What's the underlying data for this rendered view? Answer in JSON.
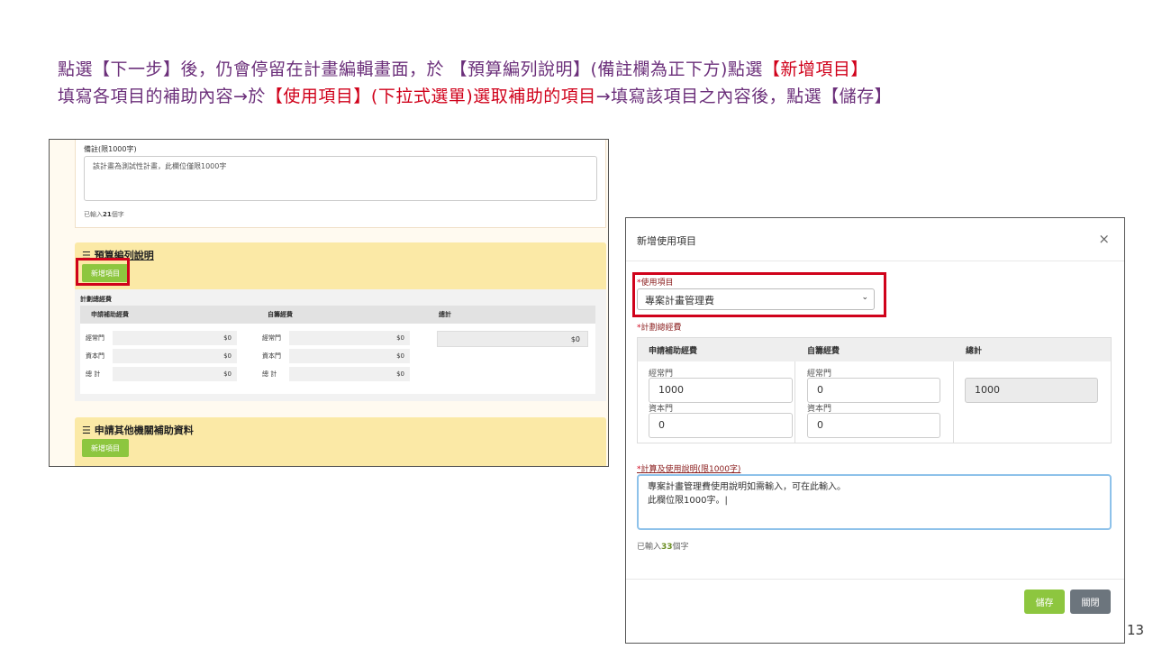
{
  "instructions": {
    "line1": [
      {
        "text": "點選【下一步】後，仍會停留在計畫編輯畫面，於 【預算編列說明】(備註欄為正下方)點選",
        "red": false
      },
      {
        "text": "【新增項目】",
        "red": true
      }
    ],
    "line2": [
      {
        "text": "填寫各項目的補助內容→於",
        "red": false
      },
      {
        "text": "【使用項目】(下拉式選單)選取補助的項目",
        "red": true
      },
      {
        "text": "→填寫該項目之內容後，點選【儲存】",
        "red": false
      }
    ]
  },
  "left_panel": {
    "note_label": "備註(限1000字)",
    "note_text": "該計畫為測試性計畫，此欄位僅限1000字",
    "note_count_prefix": "已輸入",
    "note_count": "21",
    "note_count_suffix": "個字",
    "budget_title_icon": "☰",
    "budget_title": "預算編列說明",
    "add_item_label": "新增項目",
    "plan_total_label": "計劃總經費",
    "columns": [
      "申請補助經費",
      "自籌經費",
      "總計"
    ],
    "rows": [
      {
        "label": "經常門",
        "subsidy": "$0",
        "self": "$0"
      },
      {
        "label": "資本門",
        "subsidy": "$0",
        "self": "$0"
      },
      {
        "label": "總 計",
        "subsidy": "$0",
        "self": "$0"
      }
    ],
    "grand_total": "$0",
    "other_title": "申請其他機關補助資料",
    "other_add_label": "新增項目"
  },
  "modal": {
    "title": "新增使用項目",
    "close_glyph": "×",
    "use_item_label": "使用項目",
    "use_item_value": "專案計畫管理費",
    "plan_total_label": "計劃總經費",
    "columns": [
      "申請補助經費",
      "自籌經費",
      "總計"
    ],
    "recurrent_label": "經常門",
    "capital_label": "資本門",
    "subsidy_recurrent": "1000",
    "subsidy_capital": "0",
    "self_recurrent": "0",
    "self_capital": "0",
    "total": "1000",
    "calc_label": "計算及使用說明(限1000字)",
    "calc_text_line1": "專案計畫管理費使用說明如需輸入，可在此輸入。",
    "calc_text_line2": "此欄位限1000字。",
    "count_prefix": "已輸入",
    "count": "33",
    "count_suffix": "個字",
    "save_label": "儲存",
    "close_label": "關閉"
  },
  "page_number": "13",
  "colors": {
    "instruction_text": "#6b2f7a",
    "highlight_red": "#d0021b",
    "section_yellow": "#fbe9a6",
    "button_green": "#8dc63f",
    "button_gray": "#6c757d"
  }
}
